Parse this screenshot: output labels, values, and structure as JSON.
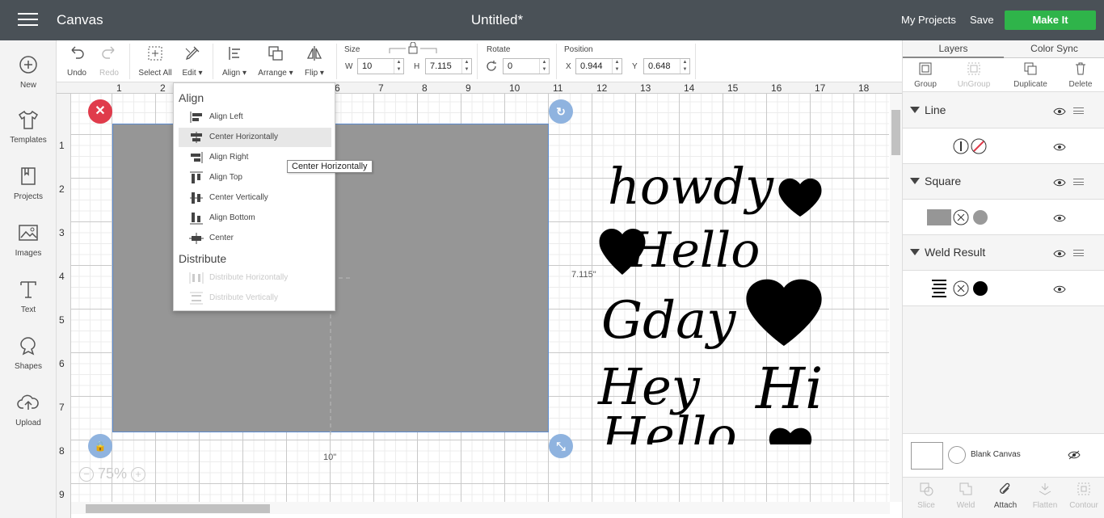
{
  "topbar": {
    "app_title": "Canvas",
    "doc_title": "Untitled*",
    "my_projects": "My Projects",
    "save": "Save",
    "make_it": "Make It"
  },
  "leftbar": [
    {
      "label": "New",
      "icon": "plus-circle-icon"
    },
    {
      "label": "Templates",
      "icon": "tshirt-icon"
    },
    {
      "label": "Projects",
      "icon": "projects-icon"
    },
    {
      "label": "Images",
      "icon": "image-icon"
    },
    {
      "label": "Text",
      "icon": "text-icon"
    },
    {
      "label": "Shapes",
      "icon": "shapes-icon"
    },
    {
      "label": "Upload",
      "icon": "upload-icon"
    }
  ],
  "toolbar": {
    "undo": "Undo",
    "redo": "Redo",
    "select_all": "Select All",
    "edit": "Edit",
    "align": "Align",
    "arrange": "Arrange",
    "flip": "Flip",
    "size_label": "Size",
    "w_label": "W",
    "w_value": "10",
    "h_label": "H",
    "h_value": "7.115",
    "rotate_label": "Rotate",
    "rotate_value": "0",
    "position_label": "Position",
    "x_label": "X",
    "x_value": "0.944",
    "y_label": "Y",
    "y_value": "0.648"
  },
  "ruler": {
    "top": [
      "1",
      "2",
      "3",
      "4",
      "5",
      "6",
      "7",
      "8",
      "9",
      "10",
      "11",
      "12",
      "13",
      "14",
      "15",
      "16",
      "17",
      "18"
    ],
    "left": [
      "1",
      "2",
      "3",
      "4",
      "5",
      "6",
      "7",
      "8",
      "9"
    ]
  },
  "canvas": {
    "width_label": "10\"",
    "height_label": "7.115\"",
    "zoom": "75%",
    "lettering": [
      "howdy",
      "Hello",
      "Gday",
      "Hey",
      "Hi",
      "Hello"
    ]
  },
  "align_menu": {
    "align_heading": "Align",
    "align_items": [
      "Align Left",
      "Center Horizontally",
      "Align Right",
      "Align Top",
      "Center Vertically",
      "Align Bottom",
      "Center"
    ],
    "distribute_heading": "Distribute",
    "distribute_items": [
      "Distribute Horizontally",
      "Distribute Vertically"
    ],
    "tooltip": "Center Horizontally"
  },
  "rightpanel": {
    "tab_layers": "Layers",
    "tab_color_sync": "Color Sync",
    "tools": [
      "Group",
      "UnGroup",
      "Duplicate",
      "Delete"
    ],
    "layers": [
      "Line",
      "Square",
      "Weld Result"
    ],
    "blank_canvas": "Blank Canvas",
    "bottom": [
      "Slice",
      "Weld",
      "Attach",
      "Flatten",
      "Contour"
    ]
  },
  "colors": {
    "topbar": "#4a5157",
    "make_it": "#2fb44a",
    "selection": "#5b8bd0",
    "delete_handle": "#e03b4b"
  }
}
